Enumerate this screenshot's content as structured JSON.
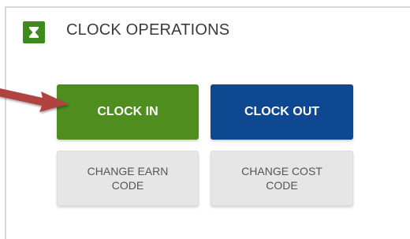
{
  "section": {
    "title": "CLOCK OPERATIONS",
    "icon": "hourglass-icon"
  },
  "buttons": {
    "clock_in": "CLOCK IN",
    "clock_out": "CLOCK OUT",
    "change_earn_code": "CHANGE EARN CODE",
    "change_cost_code": "CHANGE COST CODE"
  },
  "colors": {
    "clock_in": "#4e8d1e",
    "clock_out": "#0d4890",
    "secondary": "#e6e6e6",
    "arrow": "#b0423f"
  }
}
